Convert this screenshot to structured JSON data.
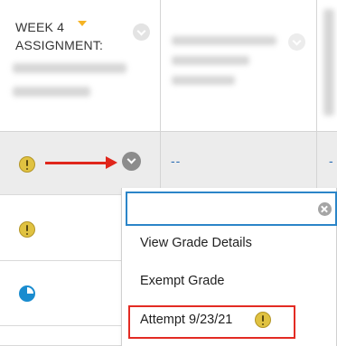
{
  "header": {
    "column_title_line1": "WEEK 4",
    "column_title_line2": "ASSIGNMENT:"
  },
  "rows": [
    {
      "status_icon": "warning-icon",
      "grade": "--",
      "grade_next": "-"
    },
    {
      "status_icon": "warning-icon"
    },
    {
      "status_icon": "in-progress-icon"
    }
  ],
  "menu": {
    "search_value": "",
    "items": [
      {
        "label": "View Grade Details"
      },
      {
        "label": "Exempt Grade"
      },
      {
        "label": "Attempt 9/23/21",
        "icon": "warning-icon"
      }
    ]
  },
  "colors": {
    "accent_blue": "#2b85c8",
    "annotation_red": "#e0261b",
    "warning_yellow": "#e0c241",
    "sort_arrow": "#f5b323"
  }
}
